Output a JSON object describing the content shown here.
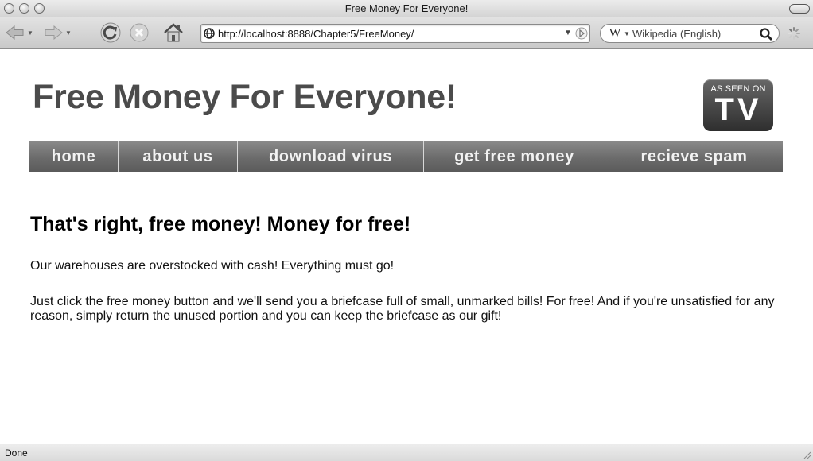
{
  "window": {
    "title": "Free Money For Everyone!"
  },
  "toolbar": {
    "url": "http://localhost:8888/Chapter5/FreeMoney/",
    "search_engine_logo": "W",
    "search_placeholder": "Wikipedia (English)",
    "icons": [
      "back-icon",
      "forward-icon",
      "reload-icon",
      "stop-icon",
      "home-icon",
      "site-globe-icon",
      "go-arrow-icon",
      "search-icon",
      "loading-spinner-icon"
    ]
  },
  "page": {
    "site_title": "Free Money For Everyone!",
    "badge": {
      "top": "AS SEEN ON",
      "big": "TV"
    },
    "nav": [
      {
        "label": "home"
      },
      {
        "label": "about us"
      },
      {
        "label": "download virus"
      },
      {
        "label": "get free money"
      },
      {
        "label": "recieve spam"
      }
    ],
    "headline": "That's right, free money! Money for free!",
    "paragraphs": [
      "Our warehouses are overstocked with cash! Everything must go!",
      "Just click the free money button and we'll send you a briefcase full of small, unmarked bills! For free! And if you're unsatisfied for any reason, simply return the unused portion and you can keep the briefcase as our gift!"
    ]
  },
  "status": {
    "text": "Done"
  },
  "colors": {
    "title_text": "#4b4b4b",
    "nav_background": "#6b6b6b",
    "nav_text": "#f2f2f2",
    "badge_background": "#3a3a3a"
  }
}
